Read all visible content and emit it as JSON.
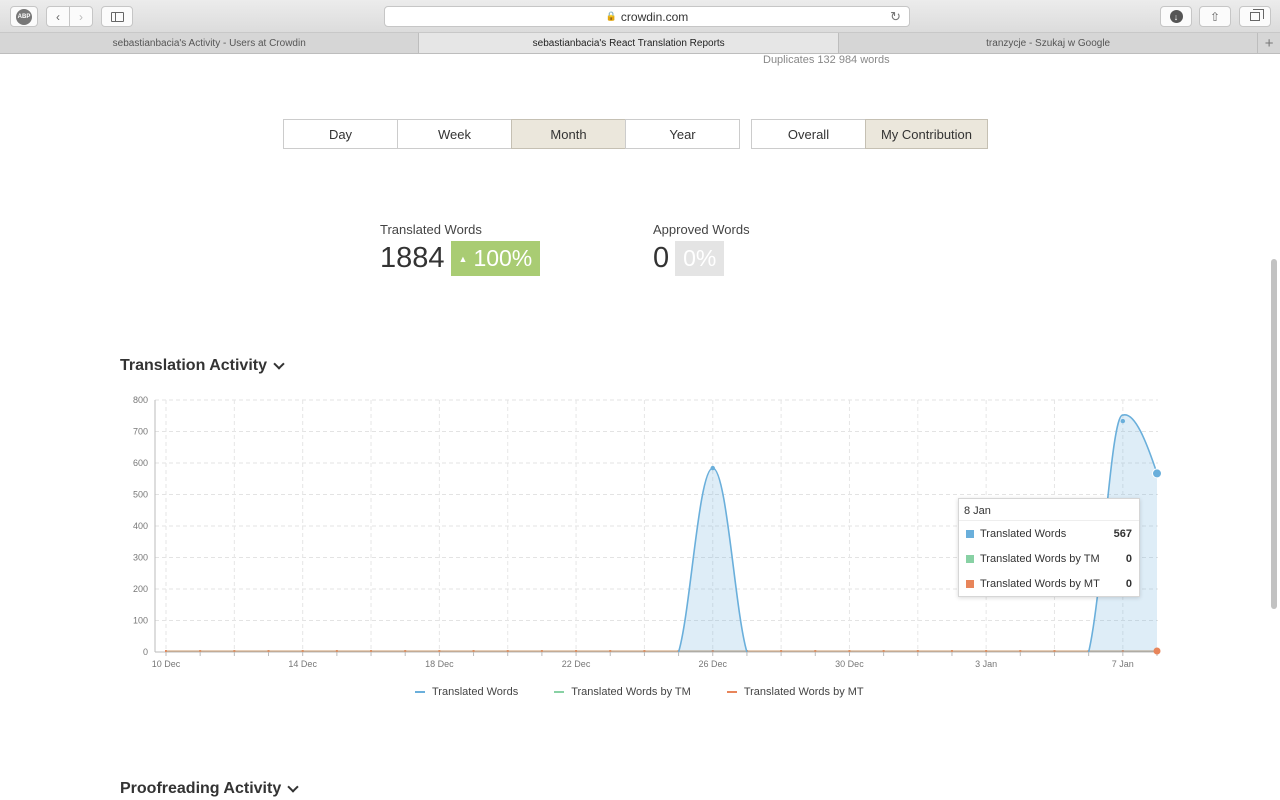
{
  "browser": {
    "url": "crowdin.com",
    "tabs": [
      {
        "label": "sebastianbacia's Activity - Users at Crowdin",
        "active": false
      },
      {
        "label": "sebastianbacia's React Translation Reports",
        "active": true
      },
      {
        "label": "tranzycje - Szukaj w Google",
        "active": false
      }
    ],
    "abp_label": "ABP"
  },
  "page": {
    "duplicates": "Duplicates 132 984 words",
    "period_buttons": [
      "Day",
      "Week",
      "Month",
      "Year"
    ],
    "active_period": "Month",
    "scope_buttons": [
      "Overall",
      "My Contribution"
    ],
    "active_scope": "My Contribution",
    "stats": {
      "translated": {
        "label": "Translated Words",
        "value": "1884",
        "change": "100%",
        "trend": "up"
      },
      "approved": {
        "label": "Approved Words",
        "value": "0",
        "change": "0%",
        "trend": "none"
      }
    },
    "section1_title": "Translation Activity",
    "section2_title": "Proofreading Activity"
  },
  "colors": {
    "translated": "#6aafdb",
    "tm": "#88d1a4",
    "mt": "#e8855a",
    "badge_up": "#a9cc73"
  },
  "chart_data": {
    "type": "area",
    "x_ticks": [
      "10 Dec",
      "14 Dec",
      "18 Dec",
      "22 Dec",
      "26 Dec",
      "30 Dec",
      "3 Jan",
      "7 Jan"
    ],
    "x_range_days": [
      "10 Dec",
      "8 Jan"
    ],
    "y_ticks": [
      0,
      100,
      200,
      300,
      400,
      500,
      600,
      700,
      800
    ],
    "ylim": [
      0,
      800
    ],
    "series": [
      {
        "name": "Translated Words",
        "color": "#6aafdb",
        "points": [
          {
            "x": "25 Dec",
            "y": 0
          },
          {
            "x": "26 Dec",
            "y": 584
          },
          {
            "x": "27 Dec",
            "y": 0
          },
          {
            "x": "6 Jan",
            "y": 0
          },
          {
            "x": "7 Jan",
            "y": 733
          },
          {
            "x": "8 Jan",
            "y": 567
          }
        ]
      },
      {
        "name": "Translated Words by TM",
        "color": "#88d1a4",
        "points": []
      },
      {
        "name": "Translated Words by MT",
        "color": "#e8855a",
        "points": []
      }
    ],
    "tooltip": {
      "date": "8 Jan",
      "rows": [
        {
          "name": "Translated Words",
          "value": "567",
          "color": "#6aafdb"
        },
        {
          "name": "Translated Words by TM",
          "value": "0",
          "color": "#88d1a4"
        },
        {
          "name": "Translated Words by MT",
          "value": "0",
          "color": "#e8855a"
        }
      ]
    },
    "legend": [
      "Translated Words",
      "Translated Words by TM",
      "Translated Words by MT"
    ]
  }
}
